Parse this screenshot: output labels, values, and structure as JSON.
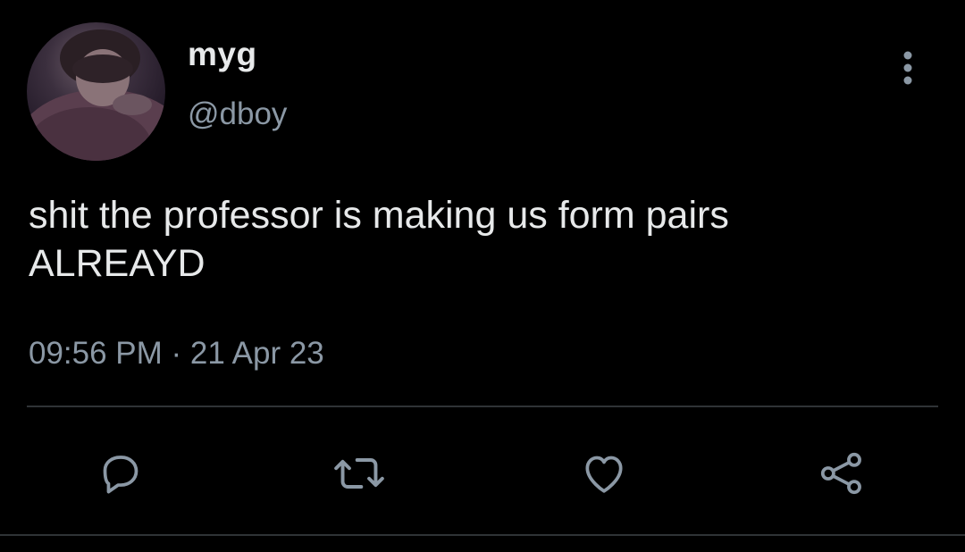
{
  "tweet": {
    "author": {
      "display_name": "myg",
      "handle": "@dboy"
    },
    "text": "shit the professor is making us form pairs\nALREAYD",
    "timestamp": "09:56 PM · 21 Apr 23"
  },
  "icons": {
    "more": "more-vertical-icon",
    "reply": "reply-icon",
    "retweet": "retweet-icon",
    "like": "heart-icon",
    "share": "share-icon"
  },
  "colors": {
    "background": "#000000",
    "primary_text": "#e7e9ea",
    "secondary_text": "#8b98a5",
    "divider": "#2f3336"
  }
}
